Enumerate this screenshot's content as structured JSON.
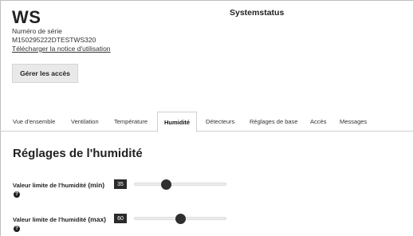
{
  "header": {
    "device_name": "WS",
    "serial_label": "Numéro de série",
    "serial_value": "M150295222DTESTWS320",
    "manual_link": "Télécharger la notice d'utilisation",
    "page_title": "Systemstatus",
    "access_button": "Gérer les accès"
  },
  "tabs": [
    {
      "label": "Vue d'ensemble",
      "active": false
    },
    {
      "label": "Ventilation",
      "active": false
    },
    {
      "label": "Température",
      "active": false
    },
    {
      "label": "Humidité",
      "active": true
    },
    {
      "label": "Détecteurs",
      "active": false
    },
    {
      "label": "Réglages de base",
      "active": false
    },
    {
      "label": "Accès",
      "active": false
    },
    {
      "label": "Messages",
      "active": false
    }
  ],
  "humidity": {
    "section_title": "Réglages de l'humidité",
    "min": {
      "label_prefix": "Valeur limite de l'humidité",
      "label_suffix": "(min)",
      "value": "35",
      "slider_fraction": 0.35,
      "help_icon": "question-circle-icon"
    },
    "max": {
      "label_prefix": "Valeur limite de l'humidité",
      "label_suffix": "(max)",
      "value": "60",
      "slider_fraction": 0.5,
      "help_icon": "question-circle-icon"
    }
  },
  "colors": {
    "badge_bg": "#2b2b2b",
    "button_bg": "#e9e9e9",
    "thumb": "#2f2f2f"
  }
}
